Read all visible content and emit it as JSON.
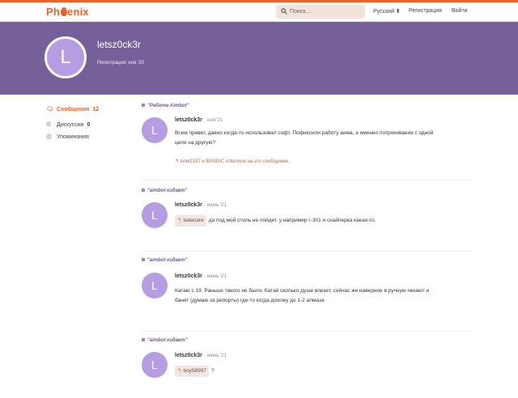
{
  "header": {
    "logo_start": "Ph",
    "logo_end": "enix",
    "search_placeholder": "Поиск...",
    "lang": "Русский ⬍",
    "register": "Регистрация",
    "login": "Войти"
  },
  "profile": {
    "avatar_letter": "L",
    "username": "letsz0ck3r",
    "registered": "Регистрация: ноя '20"
  },
  "sidebar": {
    "posts_label": "Сообщения",
    "posts_count": "12",
    "discussions_label": "Дискуссии",
    "discussions_count": "0",
    "mentions_label": "Упоминания"
  },
  "posts": [
    {
      "thread": "\"Работа Aimbot\"",
      "author": "letsz0ck3r",
      "date": "ноя '21",
      "text1": "Всем привет, давно когда-то использовал софт. Пофиксили работу аима, а именно потряхивания с одной",
      "text2": "цели на другую?",
      "replies": "Ariel1337 и BANDIC ответили на это сообщение."
    },
    {
      "thread": "\"aimbot кидает\"",
      "author": "letsz0ck3r",
      "date": "июнь '21",
      "mention": "balanare",
      "text1": "да под мой стиль не пойдет. у например г-301 и снайперка какая-то."
    },
    {
      "thread": "\"aimbot кидает\"",
      "author": "letsz0ck3r",
      "date": "июнь '21",
      "text1": "Катаю с 19. Раньше такого не было. Катай сколько душе влезет, сейчас же наверное в ручную чекают и",
      "text2": "банят (думаю за репорты) где-то когда дохожу до 1-2 алмаза"
    },
    {
      "thread": "\"aimbot кидает\"",
      "author": "letsz0ck3r",
      "date": "июнь '21",
      "mention": "boy58997",
      "text1": "?"
    }
  ],
  "icons": {
    "brand_color": "#e8622a",
    "banner_color": "#76609a",
    "avatar_color": "#b69ce0"
  }
}
